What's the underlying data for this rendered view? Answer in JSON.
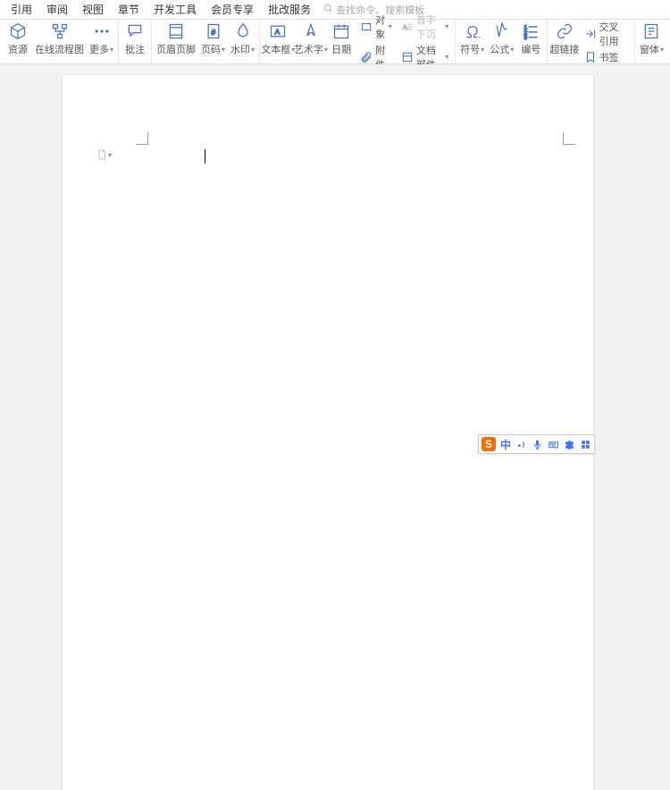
{
  "menu": {
    "items": [
      "引用",
      "审阅",
      "视图",
      "章节",
      "开发工具",
      "会员专享",
      "批改服务"
    ],
    "search_placeholder": "查找命令、搜索模板"
  },
  "ribbon": {
    "g1": {
      "a": "资源",
      "b": "在线流程图",
      "c": "更多"
    },
    "g2": {
      "a": "批注"
    },
    "g3": {
      "a": "页眉页脚",
      "b": "页码",
      "c": "水印"
    },
    "g4": {
      "a": "文本框",
      "b": "艺术字",
      "c": "日期",
      "d": "附件",
      "e": "对象",
      "f": "首字下沉",
      "g": "文档部件"
    },
    "g5": {
      "a": "符号",
      "b": "公式",
      "c": "编号"
    },
    "g6": {
      "a": "超链接",
      "b": "交叉引用",
      "c": "书签"
    },
    "g7": {
      "a": "窗体"
    }
  },
  "ime": {
    "lang": "中"
  }
}
